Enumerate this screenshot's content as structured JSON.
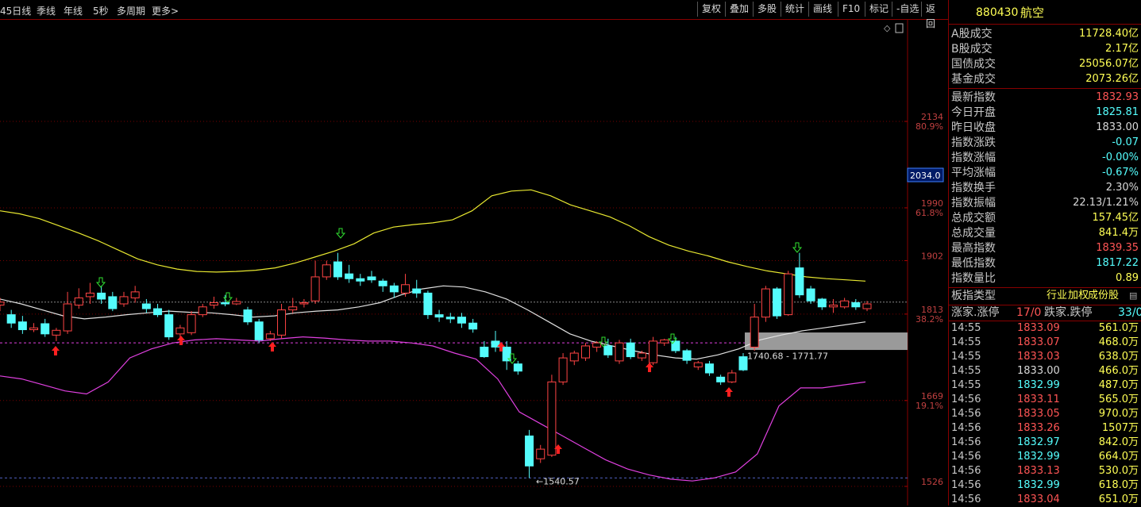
{
  "toolbar": {
    "left_items": [
      "45日线",
      "季线",
      "年线",
      "5秒",
      "多周期",
      "更多>"
    ],
    "right_buttons": [
      "复权",
      "叠加",
      "多股",
      "统计",
      "画线",
      "F10",
      "标记",
      "-自选",
      "返回"
    ]
  },
  "panel": {
    "code": "880430",
    "name": "航空",
    "volumes": [
      {
        "label": "A股成交",
        "value": "11728.40亿"
      },
      {
        "label": "B股成交",
        "value": "2.17亿"
      },
      {
        "label": "国债成交",
        "value": "25056.07亿"
      },
      {
        "label": "基金成交",
        "value": "2073.26亿"
      }
    ],
    "stats": [
      {
        "label": "最新指数",
        "value": "1832.93",
        "color": "#ff5555"
      },
      {
        "label": "今日开盘",
        "value": "1825.81",
        "color": "#55ffff"
      },
      {
        "label": "昨日收盘",
        "value": "1833.00",
        "color": "#d8d8d8"
      },
      {
        "label": "指数涨跌",
        "value": "-0.07",
        "color": "#55ffff"
      },
      {
        "label": "指数涨幅",
        "value": "-0.00%",
        "color": "#55ffff"
      },
      {
        "label": "平均涨幅",
        "value": "-0.67%",
        "color": "#55ffff"
      },
      {
        "label": "指数换手",
        "value": "2.30%",
        "color": "#d8d8d8"
      },
      {
        "label": "指数振幅",
        "value": "22.13/1.21%",
        "color": "#d8d8d8"
      },
      {
        "label": "总成交额",
        "value": "157.45亿",
        "color": "#ffff55"
      },
      {
        "label": "总成交量",
        "value": "841.4万",
        "color": "#ffff55"
      },
      {
        "label": "最高指数",
        "value": "1839.35",
        "color": "#ff5555"
      },
      {
        "label": "最低指数",
        "value": "1817.22",
        "color": "#55ffff"
      },
      {
        "label": "指数量比",
        "value": "0.89",
        "color": "#ffff55"
      }
    ],
    "index_type_label": "板指类型",
    "index_type_links": [
      "行业",
      "加权",
      "成份股"
    ],
    "breadth": {
      "up_label": "涨家.涨停",
      "up_value": "17/0",
      "down_label": "跌家.跌停",
      "down_value": "33/0"
    },
    "ticks": [
      {
        "time": "14:55",
        "price": "1833.09",
        "vol": "561.0万",
        "c": "#ff5555"
      },
      {
        "time": "14:55",
        "price": "1833.07",
        "vol": "468.0万",
        "c": "#ff5555"
      },
      {
        "time": "14:55",
        "price": "1833.03",
        "vol": "638.0万",
        "c": "#ff5555"
      },
      {
        "time": "14:55",
        "price": "1833.00",
        "vol": "466.0万",
        "c": "#d8d8d8"
      },
      {
        "time": "14:55",
        "price": "1832.99",
        "vol": "487.0万",
        "c": "#55ffff"
      },
      {
        "time": "14:56",
        "price": "1833.11",
        "vol": "565.0万",
        "c": "#ff5555"
      },
      {
        "time": "14:56",
        "price": "1833.05",
        "vol": "970.0万",
        "c": "#ff5555"
      },
      {
        "time": "14:56",
        "price": "1833.26",
        "vol": "1507万",
        "c": "#ff5555"
      },
      {
        "time": "14:56",
        "price": "1832.97",
        "vol": "842.0万",
        "c": "#55ffff"
      },
      {
        "time": "14:56",
        "price": "1832.99",
        "vol": "664.0万",
        "c": "#55ffff"
      },
      {
        "time": "14:56",
        "price": "1833.13",
        "vol": "530.0万",
        "c": "#ff5555"
      },
      {
        "time": "14:56",
        "price": "1832.99",
        "vol": "618.0万",
        "c": "#55ffff"
      },
      {
        "time": "14:56",
        "price": "1833.04",
        "vol": "651.0万",
        "c": "#ff5555"
      }
    ]
  },
  "chart_data": {
    "type": "candlestick",
    "price_ticks": [
      {
        "v": 2134,
        "pct": "80.9%"
      },
      {
        "v": 1990,
        "pct": "61.8%"
      },
      {
        "v": 1902,
        "pct": ""
      },
      {
        "v": 1813,
        "pct": "38.2%"
      },
      {
        "v": 1669,
        "pct": "19.1%"
      },
      {
        "v": 1526,
        "pct": ""
      }
    ],
    "current_price_tag": "2034.0",
    "high_price_tag": "2034.0",
    "range_label": "1740.68 - 1771.77",
    "low_label": "1540.57",
    "colors": {
      "up": "#ff4444",
      "down": "#54fcfc",
      "ma_yellow": "#e8e830",
      "ma_white": "#e0e0e0",
      "ma_magenta": "#e040e0"
    },
    "candles": [
      [
        1828,
        1833,
        1840,
        1818
      ],
      [
        1812,
        1798,
        1820,
        1790
      ],
      [
        1800,
        1787,
        1810,
        1780
      ],
      [
        1787,
        1790,
        1798,
        1783
      ],
      [
        1797,
        1780,
        1805,
        1775
      ],
      [
        1778,
        1786,
        1790,
        1768
      ],
      [
        1785,
        1830,
        1850,
        1780
      ],
      [
        1828,
        1840,
        1856,
        1822
      ],
      [
        1842,
        1848,
        1865,
        1830
      ],
      [
        1848,
        1838,
        1860,
        1830
      ],
      [
        1842,
        1822,
        1850,
        1818
      ],
      [
        1830,
        1842,
        1850,
        1825
      ],
      [
        1840,
        1850,
        1860,
        1832
      ],
      [
        1830,
        1822,
        1838,
        1815
      ],
      [
        1822,
        1812,
        1830,
        1808
      ],
      [
        1812,
        1775,
        1820,
        1770
      ],
      [
        1780,
        1790,
        1795,
        1772
      ],
      [
        1782,
        1812,
        1818,
        1778
      ],
      [
        1812,
        1825,
        1830,
        1808
      ],
      [
        1828,
        1832,
        1842,
        1822
      ],
      [
        1832,
        1830,
        1845,
        1826
      ],
      [
        1830,
        1834,
        1840,
        1828
      ],
      [
        1820,
        1800,
        1825,
        1795
      ],
      [
        1800,
        1770,
        1805,
        1765
      ],
      [
        1772,
        1780,
        1785,
        1768
      ],
      [
        1778,
        1820,
        1830,
        1772
      ],
      [
        1820,
        1825,
        1840,
        1815
      ],
      [
        1830,
        1832,
        1838,
        1824
      ],
      [
        1835,
        1875,
        1902,
        1830
      ],
      [
        1875,
        1895,
        1902,
        1870
      ],
      [
        1900,
        1875,
        1915,
        1870
      ],
      [
        1880,
        1872,
        1895,
        1865
      ],
      [
        1872,
        1868,
        1880,
        1860
      ],
      [
        1875,
        1870,
        1885,
        1865
      ],
      [
        1868,
        1860,
        1872,
        1850
      ],
      [
        1860,
        1850,
        1865,
        1840
      ],
      [
        1848,
        1862,
        1880,
        1842
      ],
      [
        1855,
        1848,
        1870,
        1840
      ],
      [
        1848,
        1812,
        1852,
        1805
      ],
      [
        1812,
        1808,
        1820,
        1800
      ],
      [
        1808,
        1805,
        1815,
        1798
      ],
      [
        1808,
        1798,
        1815,
        1790
      ],
      [
        1798,
        1788,
        1805,
        1782
      ],
      [
        1758,
        1742,
        1768,
        1740
      ],
      [
        1768,
        1758,
        1785,
        1750
      ],
      [
        1758,
        1735,
        1768,
        1720
      ],
      [
        1730,
        1718,
        1735,
        1712
      ],
      [
        1610,
        1560,
        1620,
        1540
      ],
      [
        1572,
        1588,
        1595,
        1565
      ],
      [
        1578,
        1700,
        1712,
        1575
      ],
      [
        1700,
        1740,
        1748,
        1695
      ],
      [
        1735,
        1748,
        1752,
        1728
      ],
      [
        1740,
        1760,
        1765,
        1735
      ],
      [
        1758,
        1765,
        1768,
        1750
      ],
      [
        1760,
        1745,
        1772,
        1740
      ],
      [
        1735,
        1765,
        1770,
        1730
      ],
      [
        1765,
        1742,
        1772,
        1738
      ],
      [
        1740,
        1748,
        1752,
        1735
      ],
      [
        1732,
        1768,
        1775,
        1728
      ],
      [
        1765,
        1770,
        1772,
        1760
      ],
      [
        1768,
        1752,
        1775,
        1748
      ],
      [
        1752,
        1736,
        1755,
        1730
      ],
      [
        1725,
        1732,
        1735,
        1720
      ],
      [
        1730,
        1715,
        1735,
        1710
      ],
      [
        1708,
        1700,
        1712,
        1695
      ],
      [
        1700,
        1715,
        1720,
        1698
      ],
      [
        1742,
        1720,
        1748,
        1718
      ],
      [
        1758,
        1808,
        1830,
        1752
      ],
      [
        1808,
        1855,
        1860,
        1800
      ],
      [
        1855,
        1810,
        1858,
        1805
      ],
      [
        1812,
        1880,
        1885,
        1810
      ],
      [
        1890,
        1845,
        1915,
        1840
      ],
      [
        1855,
        1835,
        1860,
        1830
      ],
      [
        1838,
        1825,
        1840,
        1820
      ],
      [
        1825,
        1828,
        1838,
        1815
      ],
      [
        1825,
        1835,
        1840,
        1822
      ],
      [
        1832,
        1825,
        1838,
        1820
      ],
      [
        1822,
        1830,
        1835,
        1818
      ]
    ],
    "ma_yellow": [
      1985,
      1980,
      1972,
      1960,
      1948,
      1935,
      1920,
      1905,
      1895,
      1888,
      1884,
      1883,
      1884,
      1886,
      1890,
      1898,
      1908,
      1918,
      1930,
      1948,
      1958,
      1962,
      1965,
      1970,
      1985,
      2010,
      2018,
      2020,
      2010,
      1995,
      1985,
      1975,
      1960,
      1942,
      1928,
      1918,
      1910,
      1900,
      1892,
      1885,
      1880,
      1875,
      1872,
      1870,
      1868
    ],
    "ma_white": [
      1838,
      1830,
      1820,
      1810,
      1805,
      1808,
      1812,
      1815,
      1818,
      1816,
      1815,
      1812,
      1808,
      1810,
      1815,
      1818,
      1820,
      1825,
      1832,
      1845,
      1855,
      1860,
      1858,
      1850,
      1838,
      1820,
      1800,
      1780,
      1768,
      1760,
      1752,
      1745,
      1740,
      1738,
      1745,
      1755,
      1770,
      1778,
      1785,
      1790,
      1795,
      1800
    ],
    "ma_magenta": [
      1710,
      1705,
      1695,
      1685,
      1680,
      1700,
      1740,
      1755,
      1765,
      1770,
      1772,
      1770,
      1768,
      1772,
      1775,
      1773,
      1770,
      1768,
      1768,
      1765,
      1760,
      1748,
      1738,
      1705,
      1650,
      1630,
      1610,
      1590,
      1570,
      1555,
      1545,
      1538,
      1535,
      1540,
      1550,
      1580,
      1660,
      1690,
      1690,
      1695,
      1700
    ]
  }
}
